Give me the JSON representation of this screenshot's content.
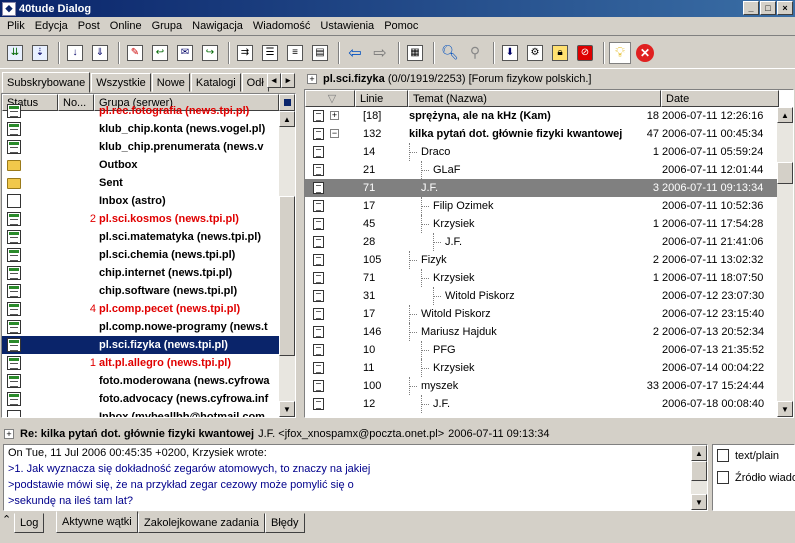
{
  "window": {
    "title": "40tude Dialog"
  },
  "menu": [
    {
      "label": "Plik"
    },
    {
      "label": "Edycja"
    },
    {
      "label": "Post"
    },
    {
      "label": "Online"
    },
    {
      "label": "Grupa"
    },
    {
      "label": "Nawigacja"
    },
    {
      "label": "Wiadomość"
    },
    {
      "label": "Ustawienia"
    },
    {
      "label": "Pomoc"
    }
  ],
  "left_tabs": [
    {
      "label": "Subskrybowane"
    },
    {
      "label": "Wszystkie"
    },
    {
      "label": "Nowe"
    },
    {
      "label": "Katalogi"
    },
    {
      "label": "Odł"
    }
  ],
  "group_list": {
    "columns": [
      "Status",
      "No...",
      "Grupa (serwer)"
    ],
    "rows": [
      {
        "count": "",
        "name": "pl.rec.fotografia (news.tpi.pl)",
        "type": "news",
        "red": true
      },
      {
        "count": "",
        "name": "klub_chip.konta (news.vogel.pl)",
        "type": "news",
        "red": false
      },
      {
        "count": "",
        "name": "klub_chip.prenumerata (news.v",
        "type": "news",
        "red": false
      },
      {
        "count": "",
        "name": "Outbox",
        "type": "folder",
        "red": false
      },
      {
        "count": "",
        "name": "Sent",
        "type": "folder",
        "red": false
      },
      {
        "count": "",
        "name": "Inbox (astro)",
        "type": "inbox",
        "red": false
      },
      {
        "count": "2",
        "name": "pl.sci.kosmos (news.tpi.pl)",
        "type": "news",
        "red": true
      },
      {
        "count": "",
        "name": "pl.sci.matematyka (news.tpi.pl)",
        "type": "news",
        "red": false
      },
      {
        "count": "",
        "name": "pl.sci.chemia (news.tpi.pl)",
        "type": "news",
        "red": false
      },
      {
        "count": "",
        "name": "chip.internet (news.tpi.pl)",
        "type": "news",
        "red": false
      },
      {
        "count": "",
        "name": "chip.software (news.tpi.pl)",
        "type": "news",
        "red": false
      },
      {
        "count": "4",
        "name": "pl.comp.pecet (news.tpi.pl)",
        "type": "news",
        "red": true
      },
      {
        "count": "",
        "name": "pl.comp.nowe-programy (news.t",
        "type": "news",
        "red": false
      },
      {
        "count": "",
        "name": "pl.sci.fizyka (news.tpi.pl)",
        "type": "news",
        "red": false,
        "selected": true
      },
      {
        "count": "1",
        "name": "alt.pl.allegro (news.tpi.pl)",
        "type": "news",
        "red": true
      },
      {
        "count": "",
        "name": "foto.moderowana (news.cyfrowa",
        "type": "news",
        "red": false
      },
      {
        "count": "",
        "name": "foto.advocacy (news.cyfrowa.inf",
        "type": "news",
        "red": false
      },
      {
        "count": "",
        "name": "Inbox (mybeallbb@hotmail.com",
        "type": "inbox",
        "red": false
      }
    ]
  },
  "group_header": {
    "name": "pl.sci.fizyka",
    "info": "(0/0/1919/2253)",
    "desc": "[Forum fizykow polskich.]"
  },
  "thread_list": {
    "columns": [
      "Linie",
      "Temat (Nazwa)",
      "Date"
    ],
    "rows": [
      {
        "lines": "[18]",
        "subject": "sprężyna, ale na kHz (Kam)",
        "count": "18",
        "date": "2006-07-11 12:26:16",
        "depth": 0,
        "bold": true,
        "exp": "+"
      },
      {
        "lines": "132",
        "subject": "kilka pytań dot. głównie fizyki kwantowej",
        "count": "47",
        "date": "2006-07-11 00:45:34",
        "depth": 0,
        "bold": true,
        "exp": "−"
      },
      {
        "lines": "14",
        "subject": "Draco",
        "count": "1",
        "date": "2006-07-11 05:59:24",
        "depth": 1
      },
      {
        "lines": "21",
        "subject": "GLaF",
        "count": "",
        "date": "2006-07-11 12:01:44",
        "depth": 2
      },
      {
        "lines": "71",
        "subject": "J.F.",
        "count": "3",
        "date": "2006-07-11 09:13:34",
        "depth": 1,
        "selected": true
      },
      {
        "lines": "17",
        "subject": "Filip Ozimek",
        "count": "",
        "date": "2006-07-11 10:52:36",
        "depth": 2
      },
      {
        "lines": "45",
        "subject": "Krzysiek",
        "count": "1",
        "date": "2006-07-11 17:54:28",
        "depth": 2
      },
      {
        "lines": "28",
        "subject": "J.F.",
        "count": "",
        "date": "2006-07-11 21:41:06",
        "depth": 3
      },
      {
        "lines": "105",
        "subject": "Fizyk",
        "count": "2",
        "date": "2006-07-11 13:02:32",
        "depth": 1
      },
      {
        "lines": "71",
        "subject": "Krzysiek",
        "count": "1",
        "date": "2006-07-11 18:07:50",
        "depth": 2
      },
      {
        "lines": "31",
        "subject": "Witold Piskorz",
        "count": "",
        "date": "2006-07-12 23:07:30",
        "depth": 3
      },
      {
        "lines": "17",
        "subject": "Witold Piskorz",
        "count": "",
        "date": "2006-07-12 23:15:40",
        "depth": 1
      },
      {
        "lines": "146",
        "subject": "Mariusz Hajduk",
        "count": "2",
        "date": "2006-07-13 20:52:34",
        "depth": 1
      },
      {
        "lines": "10",
        "subject": "PFG",
        "count": "",
        "date": "2006-07-13 21:35:52",
        "depth": 2
      },
      {
        "lines": "11",
        "subject": "Krzysiek",
        "count": "",
        "date": "2006-07-14 00:04:22",
        "depth": 2
      },
      {
        "lines": "100",
        "subject": "myszek",
        "count": "33",
        "date": "2006-07-17 15:24:44",
        "depth": 1
      },
      {
        "lines": "12",
        "subject": "J.F.",
        "count": "",
        "date": "2006-07-18 00:08:40",
        "depth": 2
      }
    ]
  },
  "message": {
    "subject": "Re: kilka pytań dot. głównie fizyki kwantowej",
    "from": "J.F. <jfox_xnospamx@poczta.onet.pl>",
    "date": "2006-07-11 09:13:34",
    "body": [
      {
        "text": "On Tue, 11 Jul 2006 00:45:35 +0200,  Krzysiek wrote:",
        "quote": false
      },
      {
        "text": ">1. Jak wyznacza się dokładność zegarów atomowych, to znaczy na jakiej",
        "quote": true
      },
      {
        "text": ">podstawie mówi się, że na przykład zegar cezowy może pomylić się o",
        "quote": true
      },
      {
        "text": ">sekundę na ileś tam lat?",
        "quote": true
      }
    ]
  },
  "parts": [
    {
      "label": "text/plain"
    },
    {
      "label": "Źródło wiadomości"
    }
  ],
  "bottom_tabs": [
    {
      "label": "Log"
    },
    {
      "label": "Aktywne wątki"
    },
    {
      "label": "Zakolejkowane zadania"
    },
    {
      "label": "Błędy"
    }
  ]
}
